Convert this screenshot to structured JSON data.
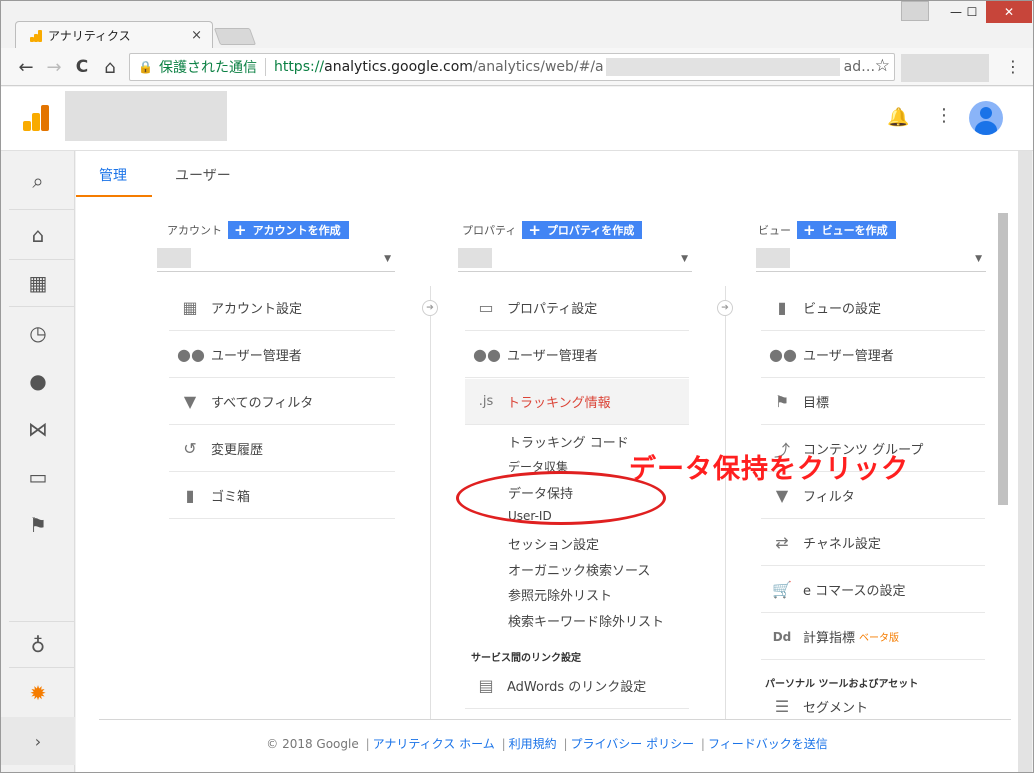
{
  "browser": {
    "tab_title": "アナリティクス",
    "tab_close": "×",
    "back": "←",
    "forward": "→",
    "reload": "C",
    "home": "⌂",
    "secure_label": "保護された通信",
    "url_scheme": "https://",
    "url_host": "analytics.google.com",
    "url_path": "/analytics/web/#/a",
    "url_tail": "ad…",
    "star": "☆",
    "menu": "⋮",
    "minimize": "—",
    "maximize": "☐",
    "close": "✕"
  },
  "header": {
    "bell": "🔔",
    "kebab": "⋮"
  },
  "leftnav": {
    "search": "⌕",
    "home": "⌂",
    "customize": "▦",
    "realtime": "◷",
    "audience": "●",
    "acquisition": "⋈",
    "behavior": "▭",
    "conversions": "⚑",
    "discover": "♁",
    "admin": "✹",
    "expand": "›"
  },
  "tabs": {
    "admin": "管理",
    "users": "ユーザー"
  },
  "account": {
    "label": "アカウント",
    "create": "アカウントを作成",
    "items": [
      {
        "icon": "▦",
        "label": "アカウント設定"
      },
      {
        "icon": "●●",
        "label": "ユーザー管理者"
      },
      {
        "icon": "▼",
        "label": "すべてのフィルタ"
      },
      {
        "icon": "↺",
        "label": "変更履歴"
      },
      {
        "icon": "▮",
        "label": "ゴミ箱"
      }
    ]
  },
  "property": {
    "label": "プロパティ",
    "create": "プロパティを作成",
    "items": [
      {
        "icon": "▭",
        "label": "プロパティ設定"
      },
      {
        "icon": "●●",
        "label": "ユーザー管理者"
      },
      {
        "icon": ".js",
        "label": "トラッキング情報"
      }
    ],
    "tracking_sub": [
      "トラッキング コード",
      "データ収集",
      "データ保持",
      "User-ID",
      "セッション設定",
      "オーガニック検索ソース",
      "参照元除外リスト",
      "検索キーワード除外リスト"
    ],
    "section_title": "サービス間のリンク設定",
    "link_items": [
      {
        "icon": "▤",
        "label": "AdWords のリンク設定"
      }
    ]
  },
  "view": {
    "label": "ビュー",
    "create": "ビューを作成",
    "items": [
      {
        "icon": "▮",
        "label": "ビューの設定"
      },
      {
        "icon": "●●",
        "label": "ユーザー管理者"
      },
      {
        "icon": "⚑",
        "label": "目標"
      },
      {
        "icon": "⤴",
        "label": "コンテンツ グループ"
      },
      {
        "icon": "▼",
        "label": "フィルタ"
      },
      {
        "icon": "⇄",
        "label": "チャネル設定"
      },
      {
        "icon": "🛒",
        "label": "e コマースの設定"
      },
      {
        "icon": "Dd",
        "label": "計算指標",
        "badge": "ベータ版"
      }
    ],
    "section_title": "パーソナル ツールおよびアセット",
    "segment": {
      "icon": "☰",
      "label": "セグメント"
    }
  },
  "annotation": {
    "text": "データ保持をクリック"
  },
  "footer": {
    "copyright": "© 2018 Google",
    "links": [
      "アナリティクス ホーム",
      "利用規約",
      "プライバシー ポリシー",
      "フィードバックを送信"
    ],
    "separator": "|"
  },
  "colors": {
    "accent": "#1a73e8",
    "orange": "#f57c00",
    "active_red": "#db4437",
    "annotation_red": "#ff1f1f"
  }
}
